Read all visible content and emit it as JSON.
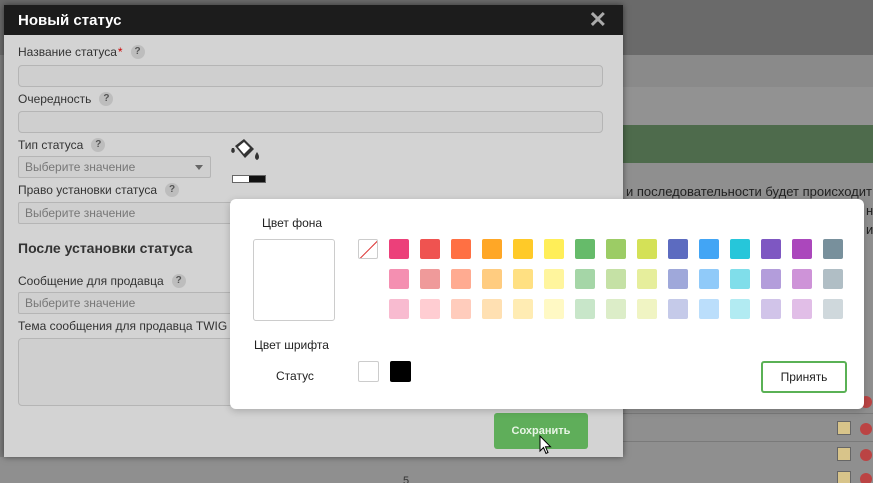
{
  "background": {
    "text_line": "и последовательности будет происходит",
    "text_line2": "н",
    "text_line3": "и",
    "page_number": "5"
  },
  "modal": {
    "title": "Новый статус",
    "close_symbol": "✕",
    "fields": {
      "status_name_label": "Название статуса",
      "required_mark": "*",
      "order_label": "Очередность",
      "status_type_label": "Тип статуса",
      "status_type_placeholder": "Выберите значение",
      "set_right_label": "Право установки статуса",
      "set_right_placeholder": "Выберите значение",
      "section_after": "После установки статуса",
      "seller_message_label": "Сообщение для продавца",
      "seller_message_placeholder": "Выберите значение",
      "seller_subject_label": "Тема сообщения для продавца TWIG"
    },
    "help_symbol": "?",
    "save_label": "Сохранить"
  },
  "picker": {
    "bg_color_label": "Цвет фона",
    "font_color_label": "Цвет шрифта",
    "status_label": "Статус",
    "accept_label": "Принять",
    "palette": [
      [
        "none",
        "#ec407a",
        "#ef5350",
        "#ff7043",
        "#ffa726",
        "#ffca28",
        "#ffee58",
        "#66bb6a",
        "#9ccc65",
        "#d4e157",
        "#5c6bc0",
        "#42a5f5",
        "#26c6da",
        "#7e57c2",
        "#ab47bc",
        "#78909c"
      ],
      [
        "",
        "#f48fb1",
        "#ef9a9a",
        "#ffab91",
        "#ffcc80",
        "#ffe082",
        "#fff59d",
        "#a5d6a7",
        "#c5e1a5",
        "#e6ee9c",
        "#9fa8da",
        "#90caf9",
        "#80deea",
        "#b39ddb",
        "#ce93d8",
        "#b0bec5"
      ],
      [
        "",
        "#f8bbd0",
        "#ffcdd2",
        "#ffccbc",
        "#ffe0b2",
        "#ffecb3",
        "#fff9c4",
        "#c8e6c9",
        "#dcedc8",
        "#f0f4c3",
        "#c5cae9",
        "#bbdefb",
        "#b2ebf2",
        "#d1c4e9",
        "#e1bee7",
        "#cfd8dc"
      ]
    ],
    "font_colors": [
      "#ffffff",
      "#000000"
    ]
  },
  "icons": [
    "paint-bucket-icon",
    "help-icon",
    "close-icon",
    "dropdown-arrow-icon",
    "edit-icon",
    "delete-icon",
    "mouse-cursor-icon"
  ]
}
